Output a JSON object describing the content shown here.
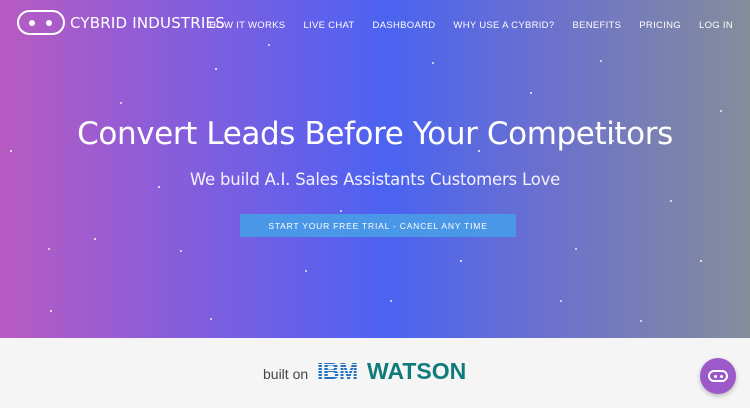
{
  "brand": {
    "name": "CYBRID INDUSTRIES",
    "logo_icon": "robot-face-icon"
  },
  "nav": {
    "items": [
      {
        "label": "HOW IT WORKS"
      },
      {
        "label": "LIVE CHAT"
      },
      {
        "label": "DASHBOARD"
      },
      {
        "label": "WHY USE A CYBRID?"
      },
      {
        "label": "BENEFITS"
      },
      {
        "label": "PRICING"
      },
      {
        "label": "LOG IN"
      }
    ]
  },
  "hero": {
    "headline": "Convert Leads Before Your Competitors",
    "subheadline": "We build A.I. Sales Assistants Customers Love",
    "cta_label": "START YOUR FREE TRIAL - CANCEL ANY TIME",
    "gradient_colors": [
      "#b85bc2",
      "#4a63f0",
      "#858d9b"
    ]
  },
  "partner": {
    "prefix": "built on",
    "ibm": "IBM",
    "watson": "WATSON",
    "ibm_color": "#1f70c1",
    "watson_color": "#0f7b7a"
  },
  "chat_widget": {
    "icon": "chat-robot-icon",
    "color": "#9b59c9"
  }
}
